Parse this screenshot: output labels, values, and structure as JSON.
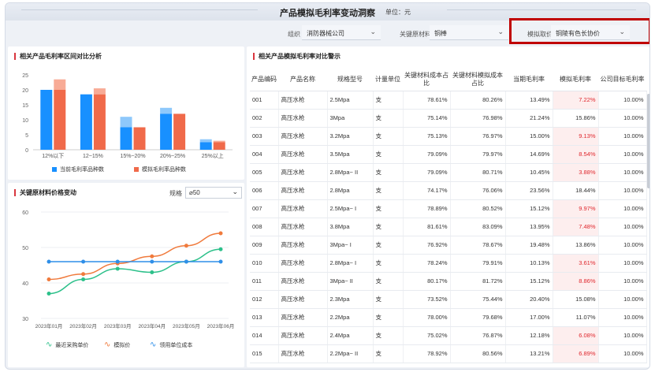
{
  "header": {
    "title": "产品模拟毛利率变动洞察",
    "unit": "单位：元"
  },
  "filters": {
    "org_label": "组织",
    "org_value": "消防器械公司",
    "material_label": "关键原材料",
    "material_value": "铜棒",
    "price_label": "模拟取价",
    "price_value": "铜陵有色长协价"
  },
  "bar_panel": {
    "title": "相关产品毛利率区间对比分析"
  },
  "line_panel": {
    "title": "关键原材料价格变动",
    "spec_label": "规格",
    "spec_value": "⌀50"
  },
  "table_panel": {
    "title": "相关产品模拟毛利率对比警示",
    "columns": [
      "产品编码",
      "产品名称",
      "规格型号",
      "计量单位",
      "关键材料成本占比",
      "关键材料模拟成本占比",
      "当期毛利率",
      "模拟毛利率",
      "公司目标毛利率"
    ],
    "rows": [
      [
        "001",
        "高压水枪",
        "2.5Mpa",
        "支",
        "78.61%",
        "80.26%",
        "13.49%",
        "7.22%",
        "10.00%"
      ],
      [
        "002",
        "高压水枪",
        "3Mpa",
        "支",
        "75.14%",
        "76.98%",
        "21.24%",
        "15.86%",
        "10.00%"
      ],
      [
        "003",
        "高压水枪",
        "3.2Mpa",
        "支",
        "75.13%",
        "76.97%",
        "15.00%",
        "9.13%",
        "10.00%"
      ],
      [
        "004",
        "高压水枪",
        "3.5Mpa",
        "支",
        "79.09%",
        "79.97%",
        "14.69%",
        "8.54%",
        "10.00%"
      ],
      [
        "005",
        "高压水枪",
        "2.8Mpa~ II",
        "支",
        "79.09%",
        "80.71%",
        "10.45%",
        "3.88%",
        "10.00%"
      ],
      [
        "006",
        "高压水枪",
        "2.8Mpa",
        "支",
        "74.17%",
        "76.06%",
        "23.56%",
        "18.44%",
        "10.00%"
      ],
      [
        "007",
        "高压水枪",
        "2.5Mpa~ I",
        "支",
        "78.89%",
        "80.52%",
        "15.12%",
        "9.97%",
        "10.00%"
      ],
      [
        "008",
        "高压水枪",
        "3.8Mpa",
        "支",
        "81.61%",
        "83.09%",
        "13.95%",
        "7.48%",
        "10.00%"
      ],
      [
        "009",
        "高压水枪",
        "3Mpa~ I",
        "支",
        "76.92%",
        "78.67%",
        "19.48%",
        "13.86%",
        "10.00%"
      ],
      [
        "010",
        "高压水枪",
        "2.8Mpa~ I",
        "支",
        "78.24%",
        "79.91%",
        "10.13%",
        "3.61%",
        "10.00%"
      ],
      [
        "011",
        "高压水枪",
        "3Mpa~ II",
        "支",
        "80.17%",
        "81.72%",
        "15.12%",
        "8.86%",
        "10.00%"
      ],
      [
        "012",
        "高压水枪",
        "2.3Mpa",
        "支",
        "73.52%",
        "75.44%",
        "20.40%",
        "15.08%",
        "10.00%"
      ],
      [
        "013",
        "高压水枪",
        "2.2Mpa",
        "支",
        "78.00%",
        "79.68%",
        "17.00%",
        "11.07%",
        "10.00%"
      ],
      [
        "014",
        "高压水枪",
        "2.4Mpa",
        "支",
        "75.02%",
        "76.87%",
        "12.18%",
        "6.08%",
        "10.00%"
      ],
      [
        "015",
        "高压水枪",
        "2.2Mpa~ II",
        "支",
        "78.92%",
        "80.56%",
        "13.21%",
        "6.89%",
        "10.00%"
      ]
    ],
    "alert_rows": [
      0,
      2,
      3,
      4,
      6,
      7,
      9,
      10,
      13,
      14
    ]
  },
  "chart_data": [
    {
      "type": "bar",
      "categories": [
        "12%以下",
        "12~15%",
        "15%~20%",
        "20%~25%",
        "25%以上"
      ],
      "series": [
        {
          "name": "当前毛利率品种数",
          "values": [
            20,
            18.5,
            11,
            14,
            3.5
          ],
          "solid_values": [
            20,
            18.5,
            7.5,
            12,
            2.5
          ],
          "color": "#1890ff"
        },
        {
          "name": "模拟毛利率品种数",
          "values": [
            23.5,
            20.5,
            7.5,
            12,
            3
          ],
          "solid_values": [
            20,
            18.5,
            7.5,
            12,
            2.5
          ],
          "color": "#f06a4a"
        }
      ],
      "yticks": [
        0,
        5,
        10,
        15,
        20,
        25
      ],
      "ylim": [
        0,
        25
      ],
      "legend": "bottom"
    },
    {
      "type": "line",
      "x": [
        "2023年01月",
        "2023年02月",
        "2023年03月",
        "2023年04月",
        "2023年05月",
        "2023年06月"
      ],
      "series": [
        {
          "name": "最近采购单价",
          "values": [
            37,
            41,
            44,
            43,
            46,
            49.5
          ],
          "color": "#2cc08a"
        },
        {
          "name": "模拟价",
          "values": [
            41,
            42.5,
            45.5,
            47.5,
            50.5,
            54
          ],
          "color": "#f07a3c"
        },
        {
          "name": "领用单位成本",
          "values": [
            46,
            46,
            46,
            46,
            46,
            46
          ],
          "color": "#2f8fe8"
        }
      ],
      "yticks": [
        30,
        40,
        50,
        60
      ],
      "ylim": [
        30,
        60
      ],
      "legend": "bottom"
    }
  ]
}
